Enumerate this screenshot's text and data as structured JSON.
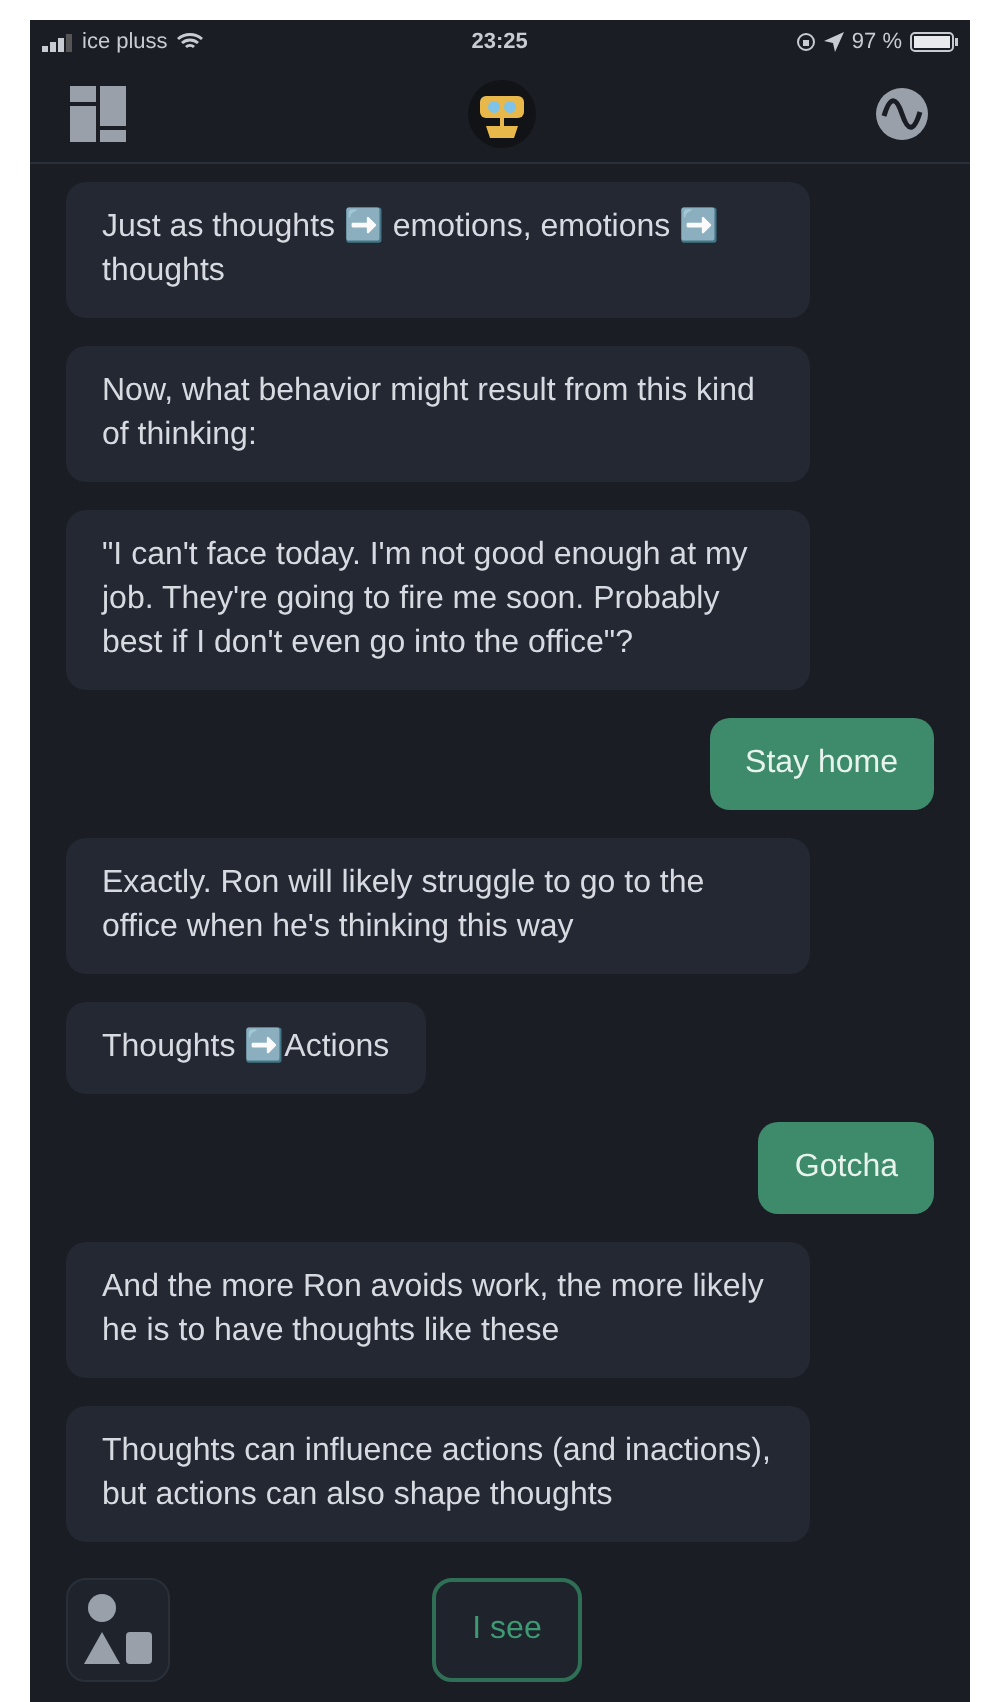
{
  "status_bar": {
    "carrier": "ice pluss",
    "time": "23:25",
    "battery": "97 %"
  },
  "messages": [
    {
      "kind": "bot",
      "text": "Just as thoughts ➡️ emotions, emotions ➡️ thoughts"
    },
    {
      "kind": "bot",
      "text": "Now, what behavior might result from this kind of thinking:"
    },
    {
      "kind": "bot",
      "text": "\"I can't face today. I'm not good enough at my job. They're going to fire me soon. Probably best if I don't even go into the office\"?"
    },
    {
      "kind": "user",
      "text": "Stay home"
    },
    {
      "kind": "bot",
      "text": "Exactly. Ron will likely struggle to go to the office when he's thinking this way"
    },
    {
      "kind": "bot",
      "text": "Thoughts ➡️Actions"
    },
    {
      "kind": "user",
      "text": "Gotcha"
    },
    {
      "kind": "bot",
      "text": "And the more Ron avoids work, the more likely he is to have thoughts like these"
    },
    {
      "kind": "bot",
      "text": "Thoughts can influence actions (and inactions), but actions can also shape thoughts"
    }
  ],
  "reply_button": {
    "label": "I see"
  }
}
